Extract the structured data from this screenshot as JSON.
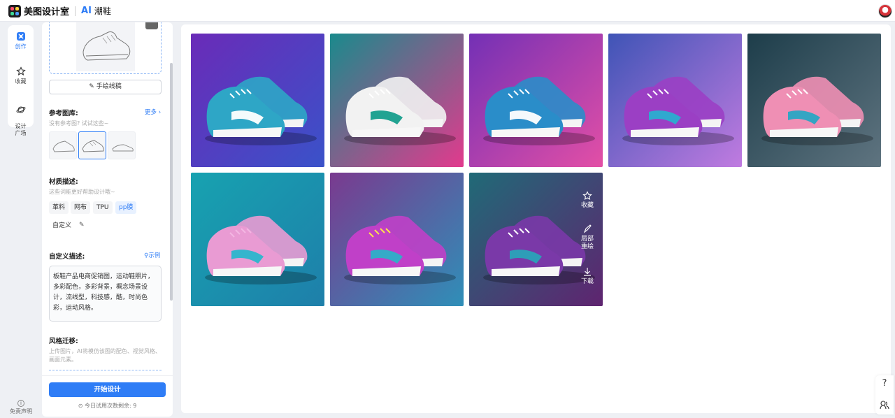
{
  "brand": {
    "name": "美图设计室",
    "ai_tag": "AI",
    "product": "潮鞋"
  },
  "rail": {
    "items": [
      {
        "label": "创作",
        "icon": "create-icon",
        "active": true
      },
      {
        "label": "收藏",
        "icon": "star-icon",
        "active": false
      },
      {
        "label": "设计\n广场",
        "icon": "planet-icon",
        "active": false
      }
    ],
    "disclaimer": "免责声明"
  },
  "panel": {
    "sketch_button": "手绘线稿",
    "reference": {
      "title": "参考图库:",
      "more": "更多",
      "empty_hint": "没有参考图? 试试这些~"
    },
    "material": {
      "title": "材质描述:",
      "hint": "这些词能更好帮助设计哦~",
      "chips": [
        "革料",
        "网布",
        "TPU",
        "pp膜",
        "自定义"
      ],
      "selected": "pp膜"
    },
    "custom": {
      "title": "自定义描述:",
      "example": "示例",
      "text": "板鞋产品电商促销图，运动鞋照片，多彩配色，多彩背景，概念场景设计，流线型，科技感，酷，时尚色彩，运动风格。"
    },
    "style": {
      "title": "风格迁移:",
      "hint": "上传图片，AI将模仿该图的配色、视觉风格、画面元素。"
    },
    "start_button": "开始设计",
    "tries_label": "今日试用次数剩余: 9"
  },
  "results": {
    "hover_actions": [
      "收藏",
      "局部\n重绘",
      "下载"
    ],
    "images": [
      {
        "bg": [
          "#6a2bb8",
          "#3a52c9"
        ],
        "shoe": "#2ea6c6",
        "accent": "#ffffff",
        "lace": "#ffffff"
      },
      {
        "bg": [
          "#1a8a8c",
          "#e23a8d"
        ],
        "shoe": "#f2f2f2",
        "accent": "#169e8c",
        "lace": "#ffffff"
      },
      {
        "bg": [
          "#7330b5",
          "#e34fa6"
        ],
        "shoe": "#2a8dc9",
        "accent": "#ffffff",
        "lace": "#ffffff"
      },
      {
        "bg": [
          "#3f54b6",
          "#c07be0"
        ],
        "shoe": "#9b3fc4",
        "accent": "#2aaed0",
        "lace": "#ffffff"
      },
      {
        "bg": [
          "#1d3d4a",
          "#5f7480"
        ],
        "shoe": "#ef8fb4",
        "accent": "#28a6c4",
        "lace": "#ffffff"
      },
      {
        "bg": [
          "#17a2b0",
          "#1e7faa"
        ],
        "shoe": "#e99bd3",
        "accent": "#2bb6cc",
        "lace": "#f3b6e3"
      },
      {
        "bg": [
          "#7a3a8f",
          "#2f8fb8"
        ],
        "shoe": "#c040c8",
        "accent": "#2db0c8",
        "lace": "#ffe34a"
      },
      {
        "bg": [
          "#206a77",
          "#5f2470"
        ],
        "shoe": "#7a39a8",
        "accent": "#2aa2b8",
        "lace": "#ffffff"
      }
    ]
  },
  "help": {
    "label": "?"
  }
}
